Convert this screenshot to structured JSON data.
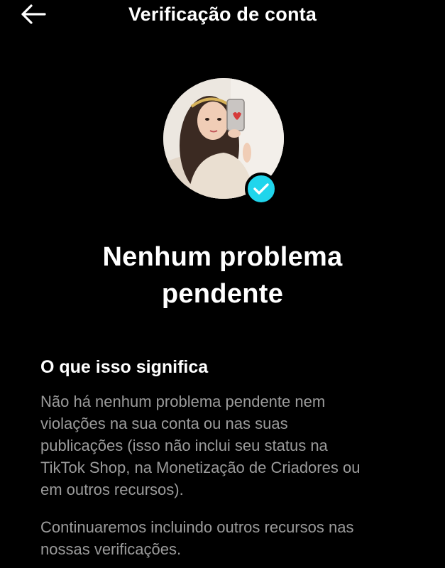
{
  "header": {
    "title": "Verificação de conta",
    "back_icon": "arrow-left-icon"
  },
  "avatar": {
    "icon": "profile-photo",
    "badge_icon": "checkmark-icon",
    "badge_color": "#20d5ec"
  },
  "status": {
    "title_lines": [
      "Nenhum problema",
      "pendente"
    ]
  },
  "section": {
    "heading": "O que isso significa",
    "paragraph1_lines": [
      "Não há nenhum problema pendente nem",
      "violações na sua conta ou nas suas",
      "publicações (isso não inclui seu status na",
      "TikTok Shop, na Monetização de Criadores ou",
      "em outros recursos)."
    ],
    "paragraph2_lines": [
      "Continuaremos incluindo outros recursos nas",
      "nossas verificações."
    ]
  },
  "colors": {
    "background": "#000000",
    "primary_text": "#ffffff",
    "secondary_text": "#9b9b9b"
  }
}
